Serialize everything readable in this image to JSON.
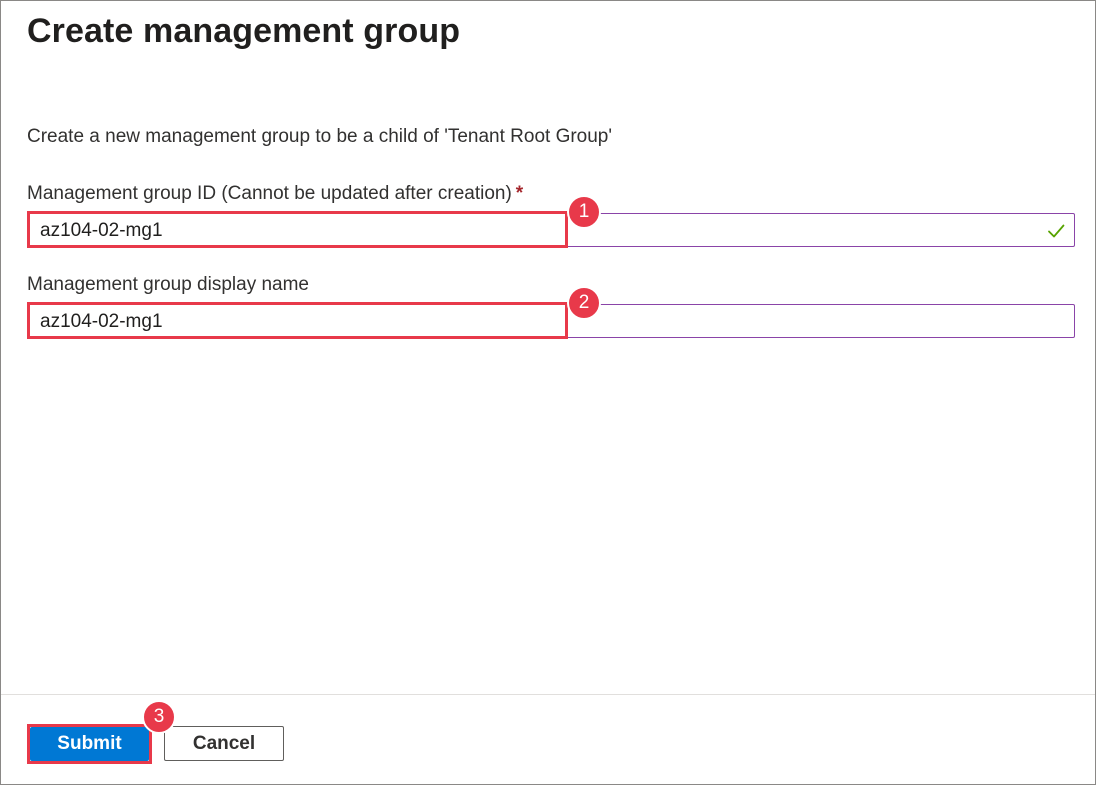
{
  "page": {
    "title": "Create management group",
    "description": "Create a new management group to be a child of 'Tenant Root Group'"
  },
  "form": {
    "group_id": {
      "label": "Management group ID (Cannot be updated after creation)",
      "required_marker": "*",
      "value": "az104-02-mg1",
      "status_icon": "checkmark-icon",
      "status_color": "#57a300"
    },
    "display_name": {
      "label": "Management group display name",
      "value": "az104-02-mg1"
    }
  },
  "actions": {
    "submit_label": "Submit",
    "cancel_label": "Cancel"
  },
  "annotations": {
    "steps": [
      "1",
      "2",
      "3"
    ],
    "color": "#e8394a"
  },
  "colors": {
    "primary": "#0078d4",
    "input_border": "#8a44a8",
    "required": "#a4262c"
  }
}
